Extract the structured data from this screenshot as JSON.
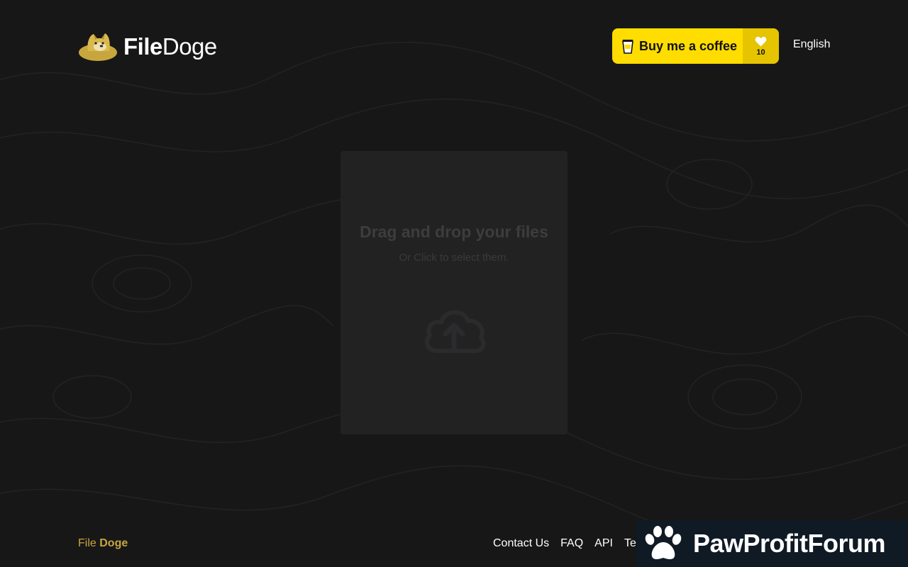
{
  "header": {
    "logo": {
      "text_bold": "File",
      "text_light": "Doge",
      "icon": "doge-icon"
    },
    "coffee_button": {
      "label": "Buy me a coffee",
      "count": "10",
      "icon": "coffee-cup-icon",
      "count_icon": "heart-icon"
    },
    "language": "English"
  },
  "dropzone": {
    "title": "Drag and drop your files",
    "subtitle": "Or Click to select them.",
    "icon": "cloud-upload-icon"
  },
  "footer": {
    "brand_prefix": "File",
    "brand_bold": "Doge",
    "links": [
      "Contact Us",
      "FAQ",
      "API",
      "Ter"
    ]
  },
  "watermark": {
    "text": "PawProfitForum",
    "icon": "paw-icon"
  },
  "colors": {
    "background": "#171718",
    "accent_yellow": "#ffdd00",
    "brand_gold": "#c8a63e",
    "dropzone_bg": "#222223"
  }
}
